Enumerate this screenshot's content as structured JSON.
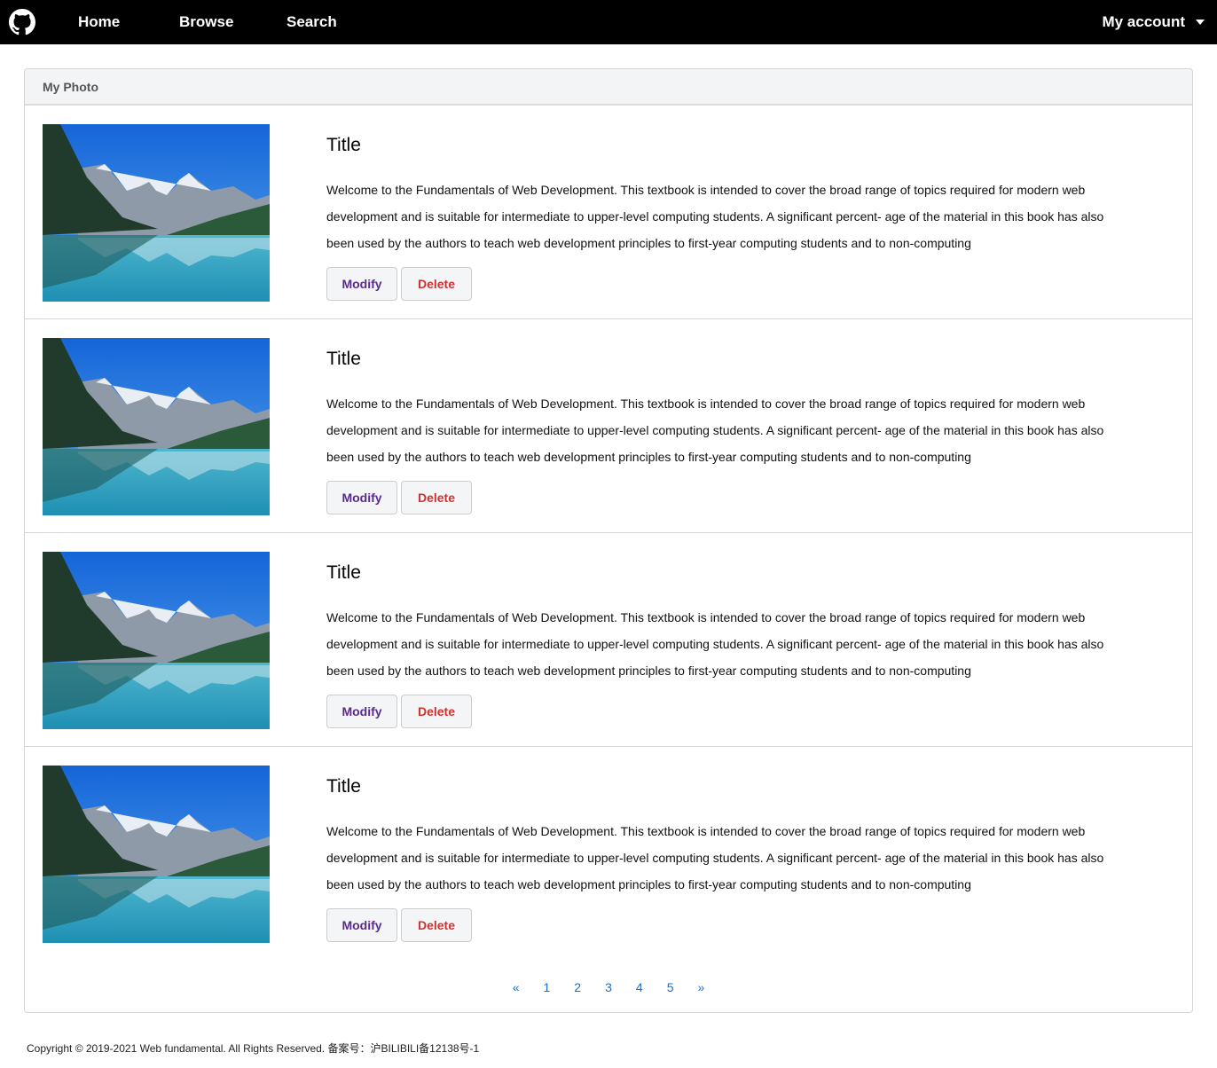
{
  "nav": {
    "home": "Home",
    "browse": "Browse",
    "search": "Search",
    "account": "My account"
  },
  "panel": {
    "header": "My Photo"
  },
  "items": [
    {
      "title": "Title",
      "description": "Welcome to the Fundamentals of Web Development. This textbook is intended to cover the broad range of topics required for modern web development and is suitable for intermediate to upper-level computing students. A significant percent- age of the material in this book has also been used by the authors to teach web development principles to first-year computing students and to non-computing",
      "modify_label": "Modify",
      "delete_label": "Delete"
    },
    {
      "title": "Title",
      "description": "Welcome to the Fundamentals of Web Development. This textbook is intended to cover the broad range of topics required for modern web development and is suitable for intermediate to upper-level computing students. A significant percent- age of the material in this book has also been used by the authors to teach web development principles to first-year computing students and to non-computing",
      "modify_label": "Modify",
      "delete_label": "Delete"
    },
    {
      "title": "Title",
      "description": "Welcome to the Fundamentals of Web Development. This textbook is intended to cover the broad range of topics required for modern web development and is suitable for intermediate to upper-level computing students. A significant percent- age of the material in this book has also been used by the authors to teach web development principles to first-year computing students and to non-computing",
      "modify_label": "Modify",
      "delete_label": "Delete"
    },
    {
      "title": "Title",
      "description": "Welcome to the Fundamentals of Web Development. This textbook is intended to cover the broad range of topics required for modern web development and is suitable for intermediate to upper-level computing students. A significant percent- age of the material in this book has also been used by the authors to teach web development principles to first-year computing students and to non-computing",
      "modify_label": "Modify",
      "delete_label": "Delete"
    }
  ],
  "pagination": {
    "prev": "«",
    "pages": [
      "1",
      "2",
      "3",
      "4",
      "5"
    ],
    "next": "»"
  },
  "footer": {
    "copyright": "Copyright © 2019-2021 Web fundamental. All Rights Reserved. 备案号：沪BILIBILI备12138号-1"
  },
  "colors": {
    "nav_bg": "#000000",
    "modify_text": "#5a2b8c",
    "delete_text": "#d1312f",
    "link": "#1a6fc9"
  }
}
